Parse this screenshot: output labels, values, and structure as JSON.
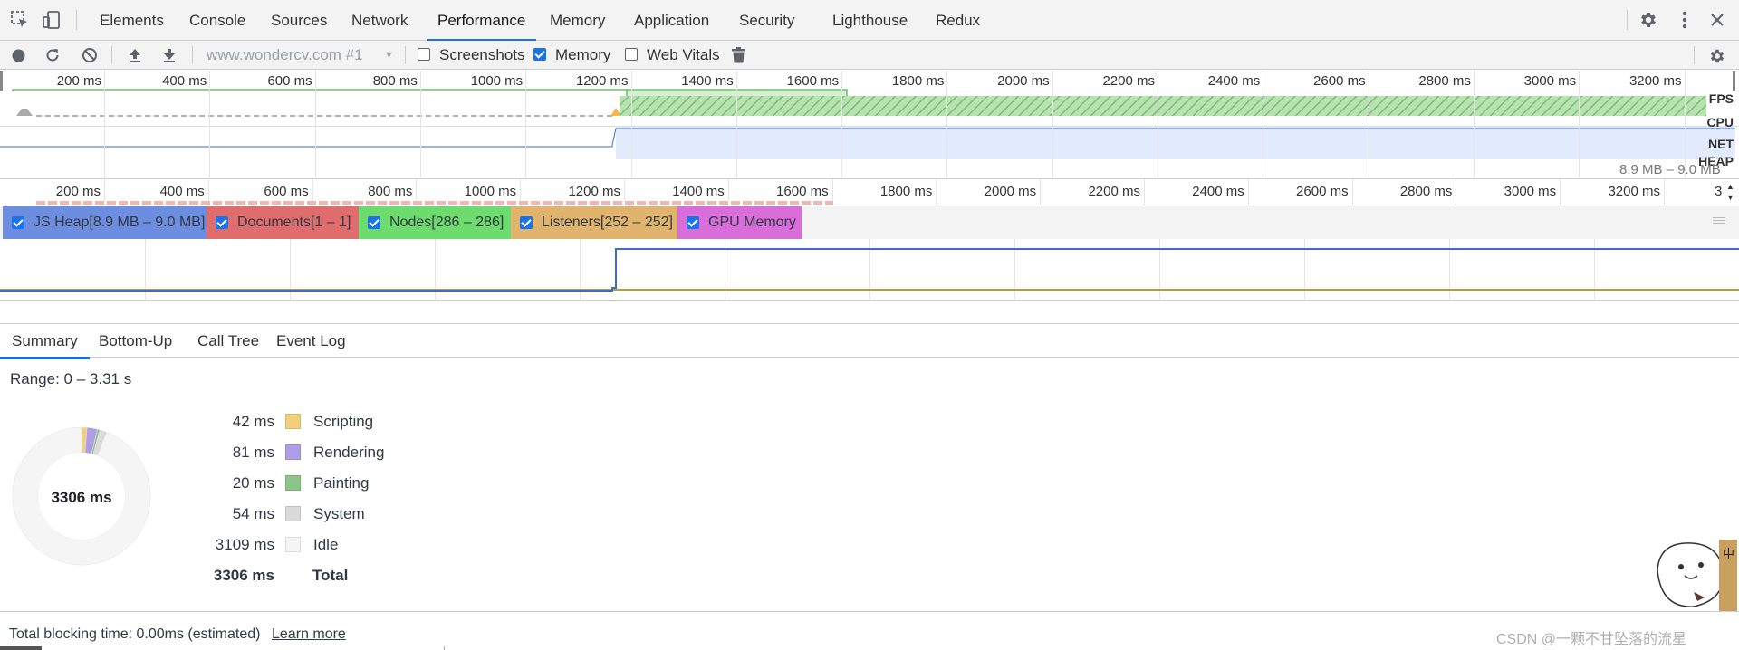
{
  "tabs": [
    {
      "label": "Elements"
    },
    {
      "label": "Console"
    },
    {
      "label": "Sources"
    },
    {
      "label": "Network"
    },
    {
      "label": "Performance"
    },
    {
      "label": "Memory"
    },
    {
      "label": "Application"
    },
    {
      "label": "Security"
    },
    {
      "label": "Lighthouse"
    },
    {
      "label": "Redux"
    }
  ],
  "toolbar": {
    "profile_select": "www.wondercv.com #1",
    "screenshots_label": "Screenshots",
    "screenshots_checked": false,
    "memory_label": "Memory",
    "memory_checked": true,
    "webvitals_label": "Web Vitals",
    "webvitals_checked": false
  },
  "overview": {
    "ticks": [
      "200 ms",
      "400 ms",
      "600 ms",
      "800 ms",
      "1000 ms",
      "1200 ms",
      "1400 ms",
      "1600 ms",
      "1800 ms",
      "2000 ms",
      "2200 ms",
      "2400 ms",
      "2600 ms",
      "2800 ms",
      "3000 ms",
      "3200 ms"
    ],
    "lanes": {
      "fps": "FPS",
      "cpu": "CPU",
      "net": "NET",
      "heap": "HEAP"
    },
    "heap_range": "8.9 MB – 9.0 MB"
  },
  "ruler": {
    "ticks": [
      "200 ms",
      "400 ms",
      "600 ms",
      "800 ms",
      "1000 ms",
      "1200 ms",
      "1400 ms",
      "1600 ms",
      "1800 ms",
      "2000 ms",
      "2200 ms",
      "2400 ms",
      "2600 ms",
      "2800 ms",
      "3000 ms",
      "3200 ms"
    ],
    "last_tick_fragment": "3"
  },
  "counters": [
    {
      "label": "JS Heap[8.9 MB – 9.0 MB]",
      "color": "#6d8ee0",
      "checked": true
    },
    {
      "label": "Documents[1 – 1]",
      "color": "#e06d6d",
      "checked": true
    },
    {
      "label": "Nodes[286 – 286]",
      "color": "#6ddb6d",
      "checked": true
    },
    {
      "label": "Listeners[252 – 252]",
      "color": "#e0b46d",
      "checked": true
    },
    {
      "label": "GPU Memory",
      "color": "#d96dd9",
      "checked": true
    }
  ],
  "bottom_tabs": [
    {
      "label": "Summary"
    },
    {
      "label": "Bottom-Up"
    },
    {
      "label": "Call Tree"
    },
    {
      "label": "Event Log"
    }
  ],
  "summary": {
    "range": "Range: 0 – 3.31 s",
    "donut_center": "3306 ms",
    "rows": [
      {
        "value": "42 ms",
        "label": "Scripting",
        "color": "#f2cf7a",
        "ms": 42
      },
      {
        "value": "81 ms",
        "label": "Rendering",
        "color": "#af9de8",
        "ms": 81
      },
      {
        "value": "20 ms",
        "label": "Painting",
        "color": "#8cc58a",
        "ms": 20
      },
      {
        "value": "54 ms",
        "label": "System",
        "color": "#dadada",
        "ms": 54
      },
      {
        "value": "3109 ms",
        "label": "Idle",
        "color": "#f5f5f5",
        "ms": 3109
      }
    ],
    "total_value": "3306 ms",
    "total_label": "Total"
  },
  "footer": {
    "blocking_time": "Total blocking time: 0.00ms (estimated)",
    "learn_more": "Learn more",
    "watermark": "CSDN @一颗不甘坠落的流星"
  },
  "colors": {
    "accent": "#1a73e8",
    "heap_line": "#3d6cd6",
    "listeners_line": "#b8a03a",
    "fps_green": "#67c36a",
    "cpu_green": "#8fce89"
  }
}
